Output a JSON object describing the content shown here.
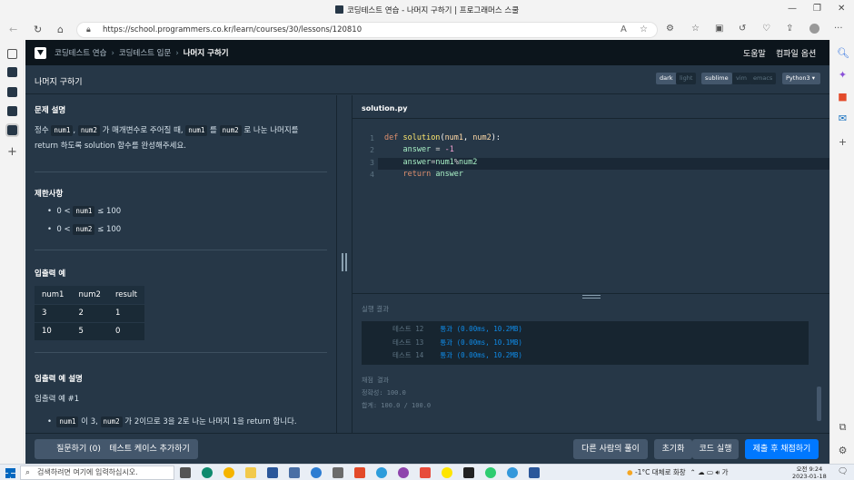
{
  "browser": {
    "tab_title": "코딩테스트 연습 - 나머지 구하기 | 프로그래머스 스쿨",
    "url": "https://school.programmers.co.kr/learn/courses/30/lessons/120810"
  },
  "header": {
    "breadcrumb": [
      "코딩테스트 연습",
      "코딩테스트 입문",
      "나머지 구하기"
    ],
    "help": "도움말",
    "compile_options": "컴파일 옵션"
  },
  "subheader": {
    "problem_title": "나머지 구하기",
    "themes": [
      "dark",
      "light"
    ],
    "keymaps": [
      "sublime",
      "vim",
      "emacs"
    ],
    "language": "Python3"
  },
  "problem": {
    "desc_heading": "문제 설명",
    "desc_line1": [
      "정수 ",
      "num1",
      ", ",
      "num2",
      " 가 매개변수로 주어질 때, ",
      "num1",
      " 를 ",
      "num2",
      " 로 나눈 나머지를"
    ],
    "desc_line2": "return 하도록 solution 함수를 완성해주세요.",
    "limits_heading": "제한사항",
    "limits": [
      {
        "pre": "0 < ",
        "code": "num1",
        "post": " ≤ 100"
      },
      {
        "pre": "0 < ",
        "code": "num2",
        "post": " ≤ 100"
      }
    ],
    "io_heading": "입출력 예",
    "io_table": {
      "headers": [
        "num1",
        "num2",
        "result"
      ],
      "rows": [
        [
          "3",
          "2",
          "1"
        ],
        [
          "10",
          "5",
          "0"
        ]
      ]
    },
    "io_desc_heading": "입출력 예 설명",
    "io_example": "입출력 예 #1",
    "io_example_line": [
      "num1",
      " 이 3, ",
      "num2",
      " 가 2이므로 3을 2로 나눈 나머지 1을 return 합니다."
    ]
  },
  "editor": {
    "filename": "solution.py",
    "line_numbers": [
      "1",
      "2",
      "3",
      "4"
    ]
  },
  "console": {
    "label": "실행 결과",
    "results": [
      {
        "name": "테스트 12",
        "status": "통과 (0.00ms, 10.2MB)"
      },
      {
        "name": "테스트 13",
        "status": "통과 (0.00ms, 10.1MB)"
      },
      {
        "name": "테스트 14",
        "status": "통과 (0.00ms, 10.2MB)"
      }
    ],
    "score_label": "채점 결과",
    "accuracy": "정확성: 100.0",
    "total": "합계: 100.0 / 100.0"
  },
  "footer": {
    "question": "질문하기 (0)",
    "add_test": "테스트 케이스 추가하기",
    "others": "다른 사람의 풀이",
    "reset": "초기화",
    "run": "코드 실행",
    "submit": "제출 후 채점하기"
  },
  "taskbar": {
    "search_placeholder": "검색하려면 여기에 입력하십시오.",
    "weather": "-1°C  대체로 화창",
    "time": "오전 9:24",
    "date": "2023-01-18"
  }
}
